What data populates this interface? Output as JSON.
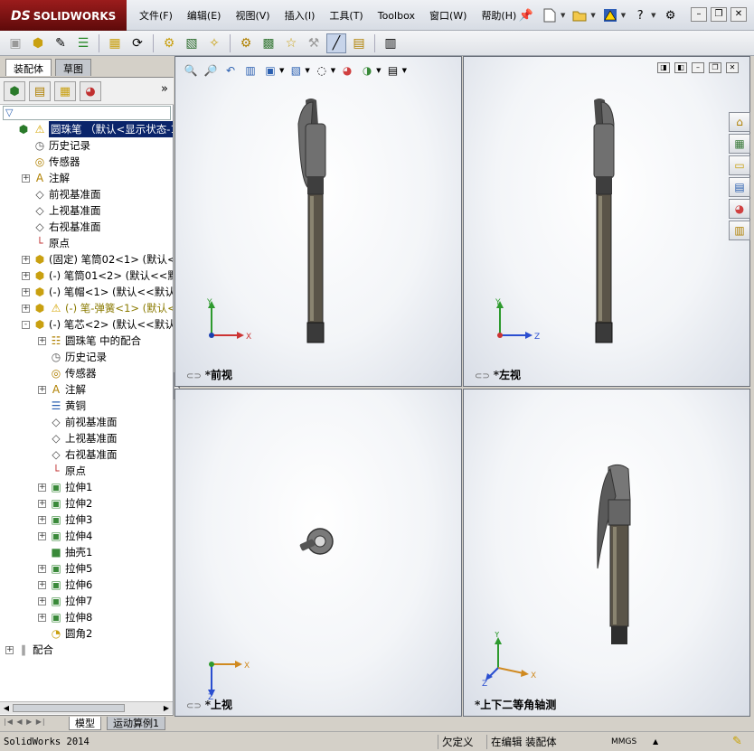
{
  "app": {
    "logo_text": "SOLIDWORKS",
    "logo_prefix": "DS"
  },
  "menu": [
    "文件(F)",
    "编辑(E)",
    "视图(V)",
    "插入(I)",
    "工具(T)",
    "Toolbox",
    "窗口(W)",
    "帮助(H)"
  ],
  "title_tools": [
    "pushpin-icon",
    "new-document-icon",
    "open-folder-icon",
    "rebuild-warning-icon",
    "help-icon",
    "options-icon"
  ],
  "window_controls": [
    "minimize",
    "restore",
    "close"
  ],
  "command_toolbar": [
    "new-part-icon",
    "assembly-icon",
    "insert-component-icon",
    "mate-icon",
    "move-component-icon",
    "rotate-component-icon",
    "smart-fasteners-icon",
    "explode-view-icon",
    "exploded-line-icon",
    "interference-icon",
    "section-icon",
    "display-pane-icon",
    "instant3d-icon",
    "line-icon",
    "view-orientation-icon"
  ],
  "left_panel": {
    "tabs": [
      "装配体",
      "草图"
    ],
    "fm_tabs": [
      "feature-manager-icon",
      "property-manager-icon",
      "config-manager-icon",
      "display-manager-icon"
    ],
    "more": "»",
    "tree": [
      {
        "label": "圆珠笔 （默认<显示状态-1>）",
        "icon": "assembly-icon",
        "indent": 0,
        "expander": "",
        "selected": true,
        "warn_icon": true
      },
      {
        "label": "历史记录",
        "icon": "history-icon",
        "indent": 1,
        "expander": ""
      },
      {
        "label": "传感器",
        "icon": "sensor-icon",
        "indent": 1,
        "expander": ""
      },
      {
        "label": "注解",
        "icon": "annotation-icon",
        "indent": 1,
        "expander": "+"
      },
      {
        "label": "前视基准面",
        "icon": "plane-icon",
        "indent": 1,
        "expander": ""
      },
      {
        "label": "上视基准面",
        "icon": "plane-icon",
        "indent": 1,
        "expander": ""
      },
      {
        "label": "右视基准面",
        "icon": "plane-icon",
        "indent": 1,
        "expander": ""
      },
      {
        "label": "原点",
        "icon": "origin-icon",
        "indent": 1,
        "expander": ""
      },
      {
        "label": "(固定) 笔筒02<1> (默认<<默",
        "icon": "part-icon",
        "indent": 1,
        "expander": "+"
      },
      {
        "label": "(-) 笔筒01<2> (默认<<默认",
        "icon": "part-icon",
        "indent": 1,
        "expander": "+"
      },
      {
        "label": "(-) 笔帽<1> (默认<<默认>_",
        "icon": "part-icon",
        "indent": 1,
        "expander": "+"
      },
      {
        "label": "(-) 笔-弹簧<1> (默认<<默",
        "icon": "part-icon",
        "indent": 1,
        "expander": "+",
        "warn": true
      },
      {
        "label": "(-) 笔芯<2> (默认<<默认>_",
        "icon": "part-icon",
        "indent": 1,
        "expander": "-"
      },
      {
        "label": "圆珠笔 中的配合",
        "icon": "mates-in-icon",
        "indent": 2,
        "expander": "+"
      },
      {
        "label": "历史记录",
        "icon": "history-icon",
        "indent": 2,
        "expander": ""
      },
      {
        "label": "传感器",
        "icon": "sensor-icon",
        "indent": 2,
        "expander": ""
      },
      {
        "label": "注解",
        "icon": "annotation-icon",
        "indent": 2,
        "expander": "+"
      },
      {
        "label": "黄铜",
        "icon": "material-icon",
        "indent": 2,
        "expander": ""
      },
      {
        "label": "前视基准面",
        "icon": "plane-icon",
        "indent": 2,
        "expander": ""
      },
      {
        "label": "上视基准面",
        "icon": "plane-icon",
        "indent": 2,
        "expander": ""
      },
      {
        "label": "右视基准面",
        "icon": "plane-icon",
        "indent": 2,
        "expander": ""
      },
      {
        "label": "原点",
        "icon": "origin-icon",
        "indent": 2,
        "expander": ""
      },
      {
        "label": "拉伸1",
        "icon": "extrude-icon",
        "indent": 2,
        "expander": "+"
      },
      {
        "label": "拉伸2",
        "icon": "extrude-icon",
        "indent": 2,
        "expander": "+"
      },
      {
        "label": "拉伸3",
        "icon": "extrude-icon",
        "indent": 2,
        "expander": "+"
      },
      {
        "label": "拉伸4",
        "icon": "extrude-icon",
        "indent": 2,
        "expander": "+"
      },
      {
        "label": "抽壳1",
        "icon": "shell-icon",
        "indent": 2,
        "expander": ""
      },
      {
        "label": "拉伸5",
        "icon": "extrude-icon",
        "indent": 2,
        "expander": "+"
      },
      {
        "label": "拉伸6",
        "icon": "extrude-icon",
        "indent": 2,
        "expander": "+"
      },
      {
        "label": "拉伸7",
        "icon": "extrude-icon",
        "indent": 2,
        "expander": "+"
      },
      {
        "label": "拉伸8",
        "icon": "extrude-icon",
        "indent": 2,
        "expander": "+"
      },
      {
        "label": "圆角2",
        "icon": "fillet-icon",
        "indent": 2,
        "expander": ""
      },
      {
        "label": "配合",
        "icon": "mates-icon",
        "indent": 0,
        "expander": "+"
      }
    ],
    "bottom_tabs": [
      "模型",
      "运动算例1"
    ]
  },
  "heads_up": [
    "zoom-to-fit-icon",
    "zoom-area-icon",
    "previous-view-icon",
    "section-view-icon",
    "view-orientation-icon",
    "display-style-icon",
    "hide-show-icon",
    "edit-appearance-icon",
    "apply-scene-icon",
    "view-settings-icon"
  ],
  "viewports": {
    "front": {
      "label": "*前视",
      "axes": [
        "Y",
        "X"
      ]
    },
    "left": {
      "label": "*左视",
      "axes": [
        "Y",
        "Z"
      ]
    },
    "top": {
      "label": "*上视",
      "axes": [
        "Z",
        "X"
      ]
    },
    "iso": {
      "label": "*上下二等角轴测",
      "axes": [
        "Y",
        "Z",
        "X"
      ]
    }
  },
  "task_pane": [
    "solidworks-resources-icon",
    "design-library-icon",
    "file-explorer-icon",
    "view-palette-icon",
    "appearances-icon",
    "custom-properties-icon"
  ],
  "status_bar": {
    "app": "SolidWorks 2014",
    "state": "欠定义",
    "editing": "在编辑 装配体",
    "units": "MMGS",
    "units_arrow": "▲"
  },
  "colors": {
    "selected_bg": "#0a246a",
    "warn_text": "#8a7a00",
    "logo_bg": "#7a1212",
    "pen_body": "#5a5448",
    "pen_cap": "#6c6c6c"
  }
}
